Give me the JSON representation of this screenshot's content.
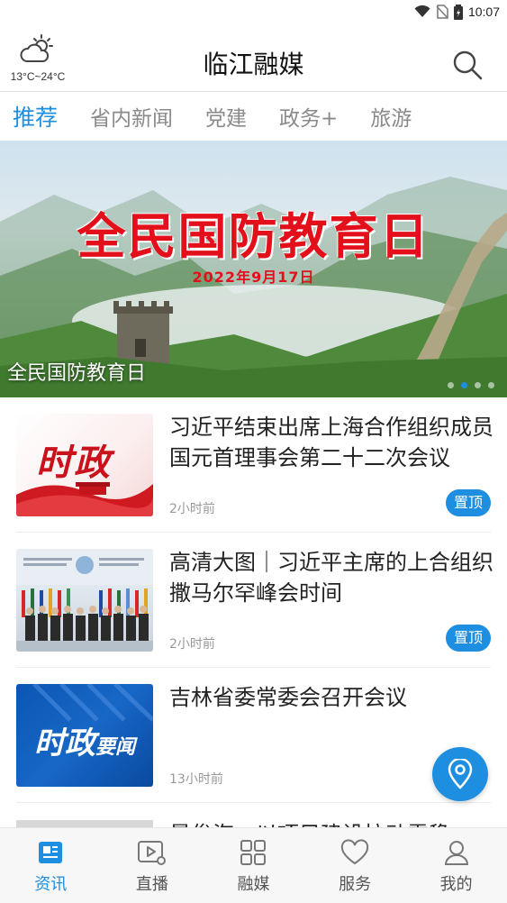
{
  "status_bar": {
    "time": "10:07"
  },
  "header": {
    "weather": {
      "icon": "partly-cloudy-icon",
      "temperature": "13°C~24°C"
    },
    "title": "临江融媒",
    "search_icon": "search-icon"
  },
  "tabs": [
    {
      "label": "推荐",
      "active": true
    },
    {
      "label": "省内新闻",
      "active": false
    },
    {
      "label": "党建",
      "active": false
    },
    {
      "label": "政务+",
      "active": false
    },
    {
      "label": "旅游",
      "active": false
    }
  ],
  "banner": {
    "headline": "全民国防教育日",
    "date": "2022年9月17日",
    "caption": "全民国防教育日",
    "slide_count": 4,
    "active_slide": 1
  },
  "news": [
    {
      "title": "习近平结束出席上海合作组织成员国元首理事会第二十二次会议",
      "time": "2小时前",
      "pinned": true,
      "badge": "置顶",
      "thumb_text": "时政"
    },
    {
      "title": "高清大图｜习近平主席的上合组织撒马尔罕峰会时间",
      "time": "2小时前",
      "pinned": true,
      "badge": "置顶"
    },
    {
      "title": "吉林省委常委会召开会议",
      "time": "13小时前",
      "pinned": false,
      "thumb_text": "时政",
      "thumb_text_small": "要闻"
    },
    {
      "title": "景俊海：以项目建设拉动需稳"
    }
  ],
  "bottom_nav": [
    {
      "label": "资讯",
      "icon": "news-icon",
      "active": true
    },
    {
      "label": "直播",
      "icon": "live-video-icon",
      "active": false
    },
    {
      "label": "融媒",
      "icon": "grid-icon",
      "active": false
    },
    {
      "label": "服务",
      "icon": "heart-icon",
      "active": false
    },
    {
      "label": "我的",
      "icon": "user-icon",
      "active": false
    }
  ],
  "colors": {
    "accent": "#1d8ee0",
    "headline_red": "#e3101b"
  }
}
